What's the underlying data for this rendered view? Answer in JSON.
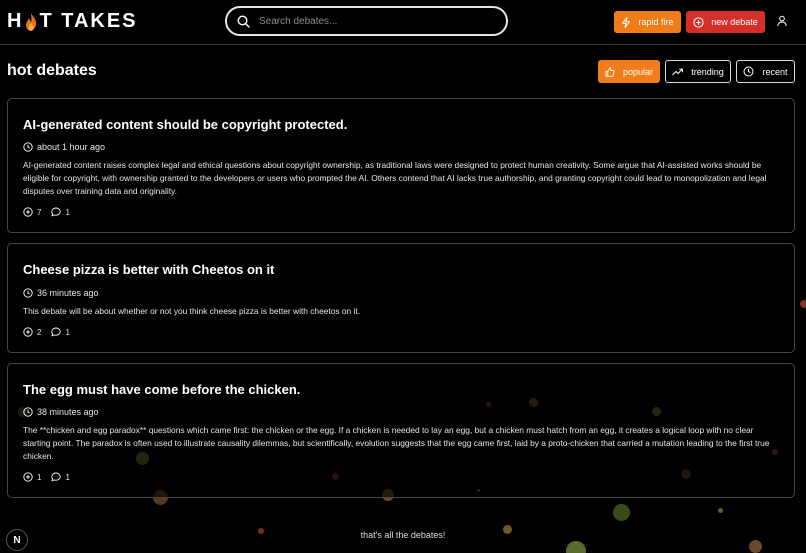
{
  "app": {
    "logo_prefix": "H",
    "logo_suffix": "T TAKES"
  },
  "search": {
    "placeholder": "Search debates..."
  },
  "header": {
    "rapid_fire": "rapid fire",
    "new_debate": "new debate"
  },
  "page": {
    "title": "hot debates"
  },
  "sort_tabs": [
    {
      "label": "popular",
      "active": true
    },
    {
      "label": "trending",
      "active": false
    },
    {
      "label": "recent",
      "active": false
    }
  ],
  "debates": [
    {
      "title": "AI-generated content should be copyright protected.",
      "time": "about 1 hour ago",
      "description": "AI-generated content raises complex legal and ethical questions about copyright ownership, as traditional laws were designed to protect human creativity. Some argue that AI-assisted works should be eligible for copyright, with ownership granted to the developers or users who prompted the AI. Others contend that AI lacks true authorship, and granting copyright could lead to monopolization and legal disputes over training data and originality.",
      "votes": "7",
      "comments": "1"
    },
    {
      "title": "Cheese pizza is better with Cheetos on it",
      "time": "36 minutes ago",
      "description": "This debate will be about whether or not you think cheese pizza is better with cheetos on it.",
      "votes": "2",
      "comments": "1"
    },
    {
      "title": "The egg must have come before the chicken.",
      "time": "38 minutes ago",
      "description": "The **chicken and egg paradox** questions which came first: the chicken or the egg. If a chicken is needed to lay an egg, but a chicken must hatch from an egg, it creates a logical loop with no clear starting point. The paradox is often used to illustrate causality dilemmas, but scientifically, evolution suggests that the egg came first, laid by a proto-chicken that carried a mutation leading to the first true chicken.",
      "votes": "1",
      "comments": "1"
    }
  ],
  "footer": {
    "end_text": "that's all the debates!",
    "badge": "N"
  },
  "colors": {
    "accent_orange": "#f07d1a",
    "accent_red": "#d62f2a",
    "background": "#000000"
  }
}
